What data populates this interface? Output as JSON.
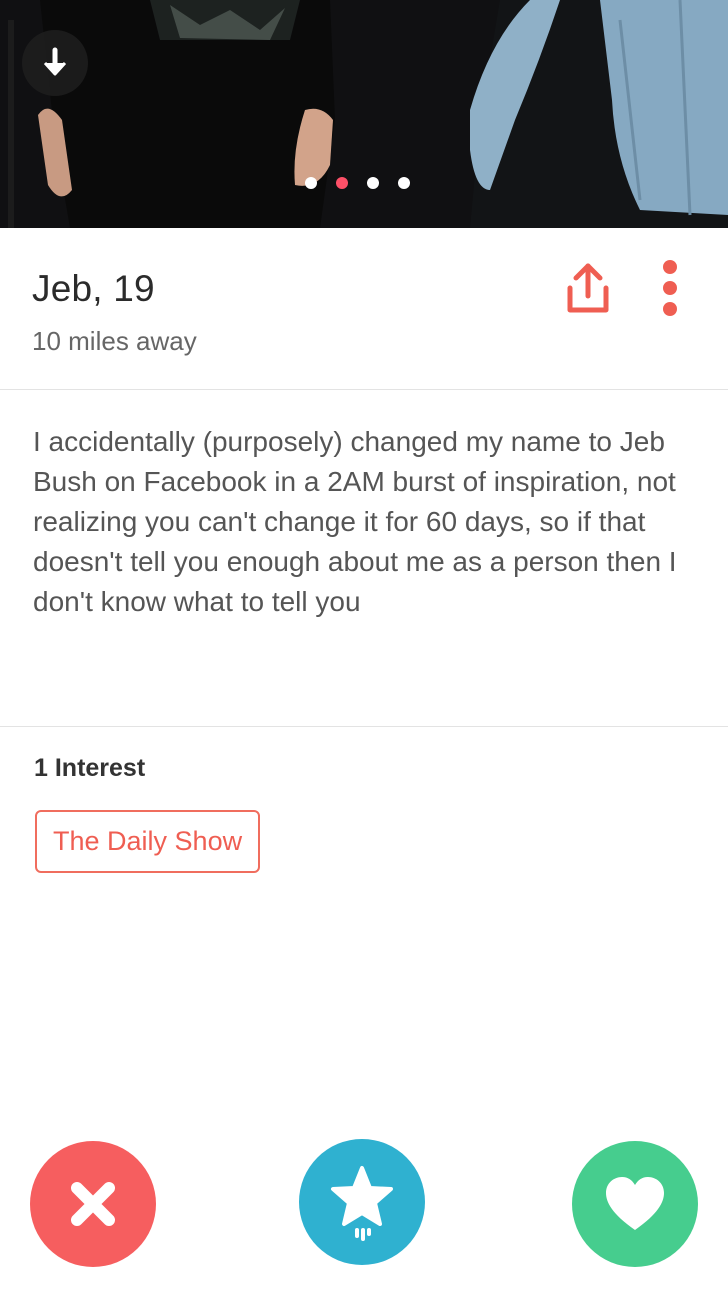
{
  "profile": {
    "name_age": "Jeb, 19",
    "distance": "10 miles away",
    "bio": "I accidentally (purposely) changed my name to Jeb Bush on Facebook in a 2AM burst of inspiration, not realizing you can't change it for 60 days, so if that doesn't tell you enough about me as a person then I don't know what to tell you"
  },
  "photo": {
    "photo_count": 4,
    "active_index": 1
  },
  "interests": {
    "title": "1 Interest",
    "items": [
      "The Daily Show"
    ]
  },
  "icons": {
    "collapse": "arrow-down-icon",
    "share": "share-icon",
    "more": "more-vertical-icon",
    "nope": "close-icon",
    "superlike": "star-icon",
    "like": "heart-icon"
  },
  "colors": {
    "brand_red": "#fd5068",
    "nope": "#f65e5f",
    "superlike": "#2fb1d0",
    "like": "#46cd8e",
    "interest_border": "#f06d5e"
  }
}
